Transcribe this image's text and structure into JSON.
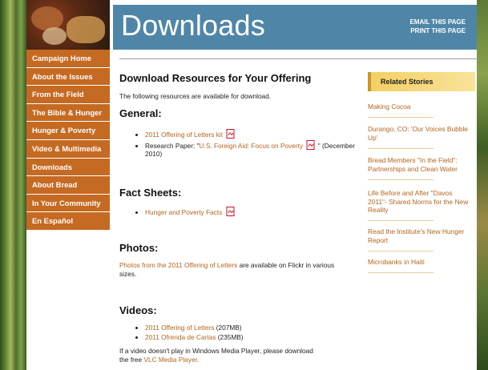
{
  "header": {
    "title": "Downloads",
    "links": [
      "EMAIL THIS PAGE",
      "PRINT THIS PAGE"
    ]
  },
  "sidebar": {
    "items": [
      "Campaign Home",
      "About the Issues",
      "From the Field",
      "The Bible & Hunger",
      "Hunger & Poverty",
      "Video & Multimedia",
      "Downloads",
      "About Bread",
      "In Your Community",
      "En Español"
    ]
  },
  "main": {
    "heading": "Download Resources for Your Offering",
    "intro": "The following resources are available for download.",
    "general": {
      "title": "General:",
      "item1_link": "2011 Offering of Letters kit",
      "item2_prefix": "Research Paper: \"",
      "item2_link": "U.S. Foreign Aid: Focus on Poverty",
      "item2_suffix": "\" (December 2010)"
    },
    "fact_sheets": {
      "title": "Fact Sheets:",
      "item1_link": "Hunger and Poverty Facts"
    },
    "photos": {
      "title": "Photos:",
      "link": "Photos from the 2011 Offering of Letters",
      "text": " are available on Flickr in various sizes."
    },
    "videos": {
      "title": "Videos:",
      "item1_link": "2011 Offering of Letters",
      "item1_size": " (207MB)",
      "item2_link": "2011 Ofrenda de Cartas",
      "item2_size": " (235MB)",
      "note_text": "If a video doesn't play in Windows Media Player, please download the free ",
      "note_link": "VLC Media Player",
      "note_end": "."
    }
  },
  "related": {
    "title": "Related Stories",
    "stories": [
      "Making Cocoa",
      "Durango, CO: 'Our Voices Bubble Up'",
      "Bread Members \"In the Field\": Partnerships and Clean Water",
      "Life Before and After \"Davos 2011\"- Shared Norms for the New Reality",
      "Read the Institute's New Hunger Report",
      "Microbanks in Haiti"
    ]
  },
  "colors": {
    "nav": "#c56a22",
    "header": "#4f86a8",
    "link": "#b5651d",
    "related_header": "#f3cf62"
  },
  "icons": {
    "pdf": "pdf-icon"
  }
}
